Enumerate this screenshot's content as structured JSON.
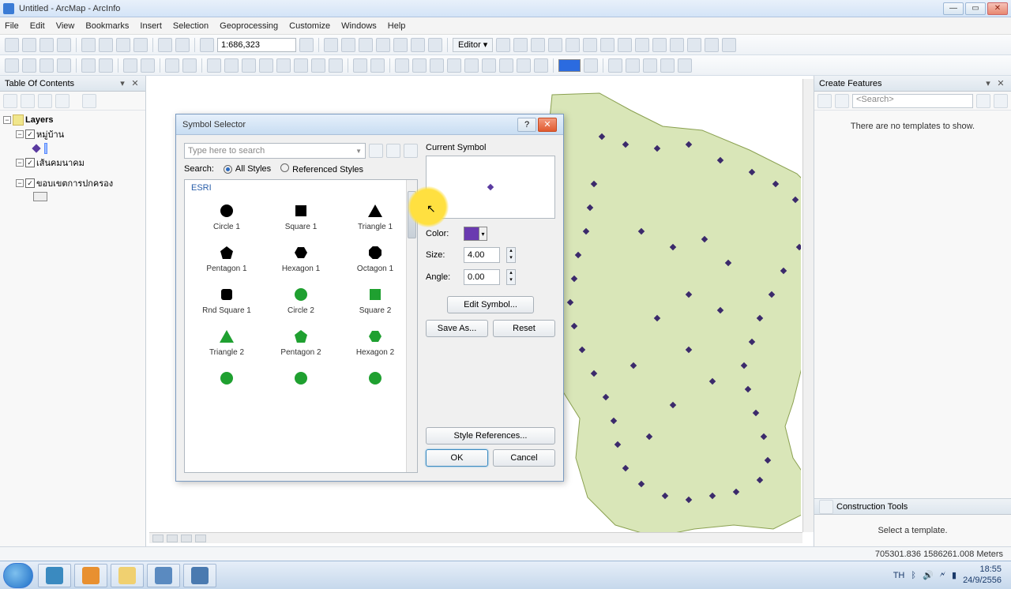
{
  "titlebar": {
    "title": "Untitled - ArcMap - ArcInfo"
  },
  "menubar": [
    "File",
    "Edit",
    "View",
    "Bookmarks",
    "Insert",
    "Selection",
    "Geoprocessing",
    "Customize",
    "Windows",
    "Help"
  ],
  "toolbar1": {
    "scale": "1:686,323",
    "editor_label": "Editor ▾"
  },
  "toc": {
    "header": "Table Of Contents",
    "root": "Layers",
    "layers": [
      {
        "name": "หมู่บ้าน",
        "checked": true
      },
      {
        "name": "เส้นคมนาคม",
        "checked": true
      },
      {
        "name": "ขอบเขตการปกครอง",
        "checked": true
      }
    ]
  },
  "create_features": {
    "header": "Create Features",
    "search_placeholder": "<Search>",
    "empty_msg": "There are no templates to show."
  },
  "construction": {
    "header": "Construction Tools",
    "hint": "Select a template."
  },
  "statusbar": {
    "coords": "705301.836  1586261.008 Meters"
  },
  "taskbar": {
    "time": "18:55",
    "date": "24/9/2556",
    "lang": "TH"
  },
  "dialog": {
    "title": "Symbol Selector",
    "search_placeholder": "Type here to search",
    "search_label": "Search:",
    "radio_all": "All Styles",
    "radio_ref": "Referenced Styles",
    "group_header": "ESRI",
    "symbols": [
      {
        "label": "Circle 1",
        "shape": "circle",
        "color": "k"
      },
      {
        "label": "Square 1",
        "shape": "square",
        "color": "k"
      },
      {
        "label": "Triangle 1",
        "shape": "triangle",
        "color": "k"
      },
      {
        "label": "Pentagon 1",
        "shape": "pentagon",
        "color": "k"
      },
      {
        "label": "Hexagon 1",
        "shape": "hexagon",
        "color": "k"
      },
      {
        "label": "Octagon 1",
        "shape": "octagon",
        "color": "k"
      },
      {
        "label": "Rnd Square 1",
        "shape": "rnd-square",
        "color": "k"
      },
      {
        "label": "Circle 2",
        "shape": "circle",
        "color": "g"
      },
      {
        "label": "Square 2",
        "shape": "square",
        "color": "g"
      },
      {
        "label": "Triangle 2",
        "shape": "triangle",
        "color": "g"
      },
      {
        "label": "Pentagon 2",
        "shape": "pentagon",
        "color": "g"
      },
      {
        "label": "Hexagon 2",
        "shape": "hexagon",
        "color": "g"
      }
    ],
    "extra_row_shapes": [
      "circle",
      "circle",
      "circle"
    ],
    "current_symbol_label": "Current Symbol",
    "color_label": "Color:",
    "size_label": "Size:",
    "size_value": "4.00",
    "angle_label": "Angle:",
    "angle_value": "0.00",
    "edit_btn": "Edit Symbol...",
    "save_btn": "Save As...",
    "reset_btn": "Reset",
    "style_refs": "Style References...",
    "ok": "OK",
    "cancel": "Cancel"
  }
}
